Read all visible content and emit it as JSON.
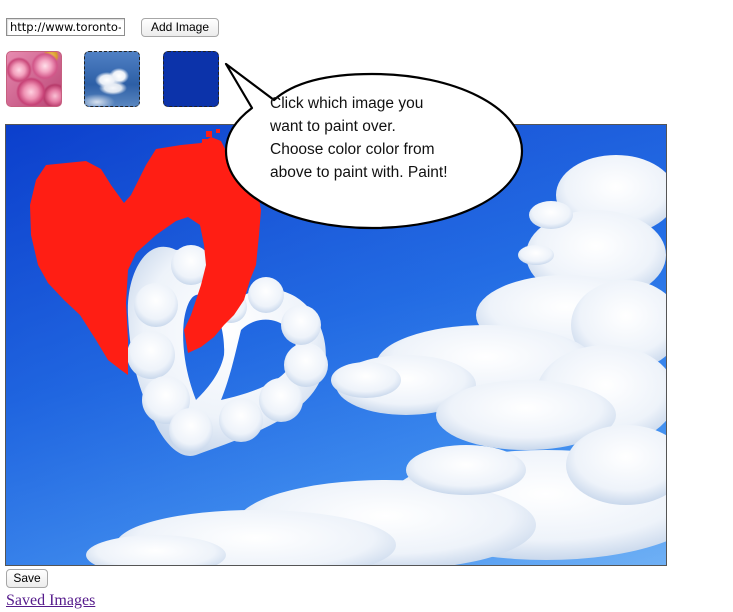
{
  "url_input": {
    "value": "http://www.toronto-"
  },
  "buttons": {
    "add_image": "Add Image",
    "save": "Save"
  },
  "thumbnails": [
    {
      "name": "roses",
      "selected": false
    },
    {
      "name": "clouds",
      "selected": true
    },
    {
      "name": "solid-blue",
      "selected": true
    }
  ],
  "colors": {
    "paint_red": "#ff1e14",
    "swatch_blue": "#0c33aa",
    "sky_blue": "#1c6ae6",
    "link_visited": "#551a8b"
  },
  "bubble": {
    "lines": [
      "Click which image you",
      "want to paint over.",
      "Choose color color from",
      "above to paint with. Paint!"
    ]
  },
  "links": {
    "saved_images": "Saved Images"
  }
}
